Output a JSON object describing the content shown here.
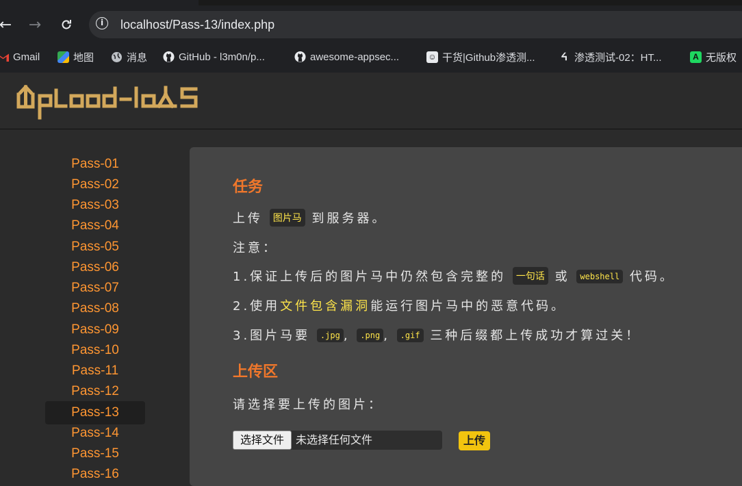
{
  "browser": {
    "url": "localhost/Pass-13/index.php",
    "bookmarks": [
      {
        "label": "Gmail"
      },
      {
        "label": "地图"
      },
      {
        "label": "消息"
      },
      {
        "label": "GitHub - l3m0n/p..."
      },
      {
        "label": "awesome-appsec..."
      },
      {
        "label": "干货|Github渗透测..."
      },
      {
        "label": "渗透测试-02：HT..."
      },
      {
        "label": "无版权"
      }
    ]
  },
  "site": {
    "logo_text": "Upload-labs"
  },
  "sidebar": {
    "active": "Pass-13",
    "items": [
      "Pass-01",
      "Pass-02",
      "Pass-03",
      "Pass-04",
      "Pass-05",
      "Pass-06",
      "Pass-07",
      "Pass-08",
      "Pass-09",
      "Pass-10",
      "Pass-11",
      "Pass-12",
      "Pass-13",
      "Pass-14",
      "Pass-15",
      "Pass-16"
    ]
  },
  "task": {
    "heading": "任务",
    "line1_pre": "上传",
    "line1_code": "图片马",
    "line1_post": "到服务器。",
    "note": "注意：",
    "item1_pre": "1.保证上传后的图片马中仍然包含完整的",
    "item1_code1": "一句话",
    "item1_mid": "或",
    "item1_code2": "webshell",
    "item1_post": "代码。",
    "item2_pre": "2.使用",
    "item2_hl": "文件包含漏洞",
    "item2_post": "能运行图片马中的恶意代码。",
    "item3_pre": "3.图片马要",
    "item3_code1": ".jpg",
    "item3_sep1": ",",
    "item3_code2": ".png",
    "item3_sep2": ",",
    "item3_code3": ".gif",
    "item3_post": "三种后缀都上传成功才算过关！"
  },
  "upload": {
    "heading": "上传区",
    "prompt": "请选择要上传的图片：",
    "choose_label": "选择文件",
    "no_file_text": "未选择任何文件",
    "submit_label": "上传"
  },
  "colors": {
    "accent": "#ff9632",
    "heading": "#f0772b",
    "code_text": "#ffe54a",
    "button": "#f2c40f"
  }
}
